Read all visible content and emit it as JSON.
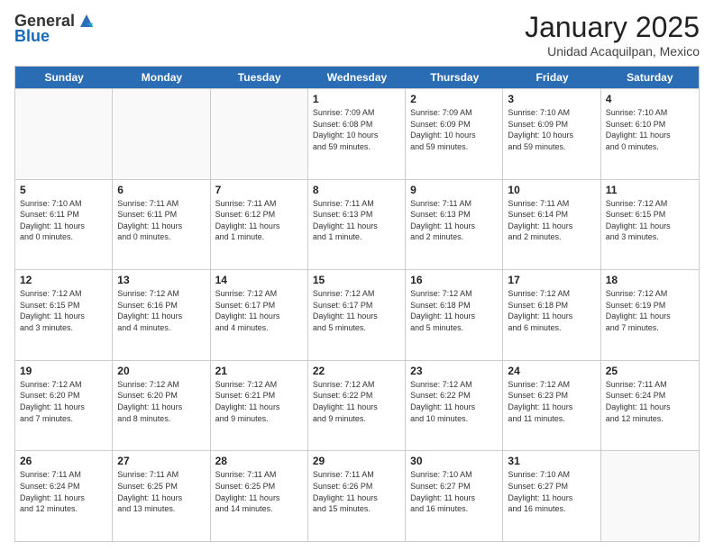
{
  "logo": {
    "general": "General",
    "blue": "Blue"
  },
  "title": "January 2025",
  "location": "Unidad Acaquilpan, Mexico",
  "days": [
    "Sunday",
    "Monday",
    "Tuesday",
    "Wednesday",
    "Thursday",
    "Friday",
    "Saturday"
  ],
  "weeks": [
    [
      {
        "day": "",
        "info": "",
        "empty": true
      },
      {
        "day": "",
        "info": "",
        "empty": true
      },
      {
        "day": "",
        "info": "",
        "empty": true
      },
      {
        "day": "1",
        "info": "Sunrise: 7:09 AM\nSunset: 6:08 PM\nDaylight: 10 hours\nand 59 minutes."
      },
      {
        "day": "2",
        "info": "Sunrise: 7:09 AM\nSunset: 6:09 PM\nDaylight: 10 hours\nand 59 minutes."
      },
      {
        "day": "3",
        "info": "Sunrise: 7:10 AM\nSunset: 6:09 PM\nDaylight: 10 hours\nand 59 minutes."
      },
      {
        "day": "4",
        "info": "Sunrise: 7:10 AM\nSunset: 6:10 PM\nDaylight: 11 hours\nand 0 minutes."
      }
    ],
    [
      {
        "day": "5",
        "info": "Sunrise: 7:10 AM\nSunset: 6:11 PM\nDaylight: 11 hours\nand 0 minutes."
      },
      {
        "day": "6",
        "info": "Sunrise: 7:11 AM\nSunset: 6:11 PM\nDaylight: 11 hours\nand 0 minutes."
      },
      {
        "day": "7",
        "info": "Sunrise: 7:11 AM\nSunset: 6:12 PM\nDaylight: 11 hours\nand 1 minute."
      },
      {
        "day": "8",
        "info": "Sunrise: 7:11 AM\nSunset: 6:13 PM\nDaylight: 11 hours\nand 1 minute."
      },
      {
        "day": "9",
        "info": "Sunrise: 7:11 AM\nSunset: 6:13 PM\nDaylight: 11 hours\nand 2 minutes."
      },
      {
        "day": "10",
        "info": "Sunrise: 7:11 AM\nSunset: 6:14 PM\nDaylight: 11 hours\nand 2 minutes."
      },
      {
        "day": "11",
        "info": "Sunrise: 7:12 AM\nSunset: 6:15 PM\nDaylight: 11 hours\nand 3 minutes."
      }
    ],
    [
      {
        "day": "12",
        "info": "Sunrise: 7:12 AM\nSunset: 6:15 PM\nDaylight: 11 hours\nand 3 minutes."
      },
      {
        "day": "13",
        "info": "Sunrise: 7:12 AM\nSunset: 6:16 PM\nDaylight: 11 hours\nand 4 minutes."
      },
      {
        "day": "14",
        "info": "Sunrise: 7:12 AM\nSunset: 6:17 PM\nDaylight: 11 hours\nand 4 minutes."
      },
      {
        "day": "15",
        "info": "Sunrise: 7:12 AM\nSunset: 6:17 PM\nDaylight: 11 hours\nand 5 minutes."
      },
      {
        "day": "16",
        "info": "Sunrise: 7:12 AM\nSunset: 6:18 PM\nDaylight: 11 hours\nand 5 minutes."
      },
      {
        "day": "17",
        "info": "Sunrise: 7:12 AM\nSunset: 6:18 PM\nDaylight: 11 hours\nand 6 minutes."
      },
      {
        "day": "18",
        "info": "Sunrise: 7:12 AM\nSunset: 6:19 PM\nDaylight: 11 hours\nand 7 minutes."
      }
    ],
    [
      {
        "day": "19",
        "info": "Sunrise: 7:12 AM\nSunset: 6:20 PM\nDaylight: 11 hours\nand 7 minutes."
      },
      {
        "day": "20",
        "info": "Sunrise: 7:12 AM\nSunset: 6:20 PM\nDaylight: 11 hours\nand 8 minutes."
      },
      {
        "day": "21",
        "info": "Sunrise: 7:12 AM\nSunset: 6:21 PM\nDaylight: 11 hours\nand 9 minutes."
      },
      {
        "day": "22",
        "info": "Sunrise: 7:12 AM\nSunset: 6:22 PM\nDaylight: 11 hours\nand 9 minutes."
      },
      {
        "day": "23",
        "info": "Sunrise: 7:12 AM\nSunset: 6:22 PM\nDaylight: 11 hours\nand 10 minutes."
      },
      {
        "day": "24",
        "info": "Sunrise: 7:12 AM\nSunset: 6:23 PM\nDaylight: 11 hours\nand 11 minutes."
      },
      {
        "day": "25",
        "info": "Sunrise: 7:11 AM\nSunset: 6:24 PM\nDaylight: 11 hours\nand 12 minutes."
      }
    ],
    [
      {
        "day": "26",
        "info": "Sunrise: 7:11 AM\nSunset: 6:24 PM\nDaylight: 11 hours\nand 12 minutes."
      },
      {
        "day": "27",
        "info": "Sunrise: 7:11 AM\nSunset: 6:25 PM\nDaylight: 11 hours\nand 13 minutes."
      },
      {
        "day": "28",
        "info": "Sunrise: 7:11 AM\nSunset: 6:25 PM\nDaylight: 11 hours\nand 14 minutes."
      },
      {
        "day": "29",
        "info": "Sunrise: 7:11 AM\nSunset: 6:26 PM\nDaylight: 11 hours\nand 15 minutes."
      },
      {
        "day": "30",
        "info": "Sunrise: 7:10 AM\nSunset: 6:27 PM\nDaylight: 11 hours\nand 16 minutes."
      },
      {
        "day": "31",
        "info": "Sunrise: 7:10 AM\nSunset: 6:27 PM\nDaylight: 11 hours\nand 16 minutes."
      },
      {
        "day": "",
        "info": "",
        "empty": true
      }
    ]
  ]
}
